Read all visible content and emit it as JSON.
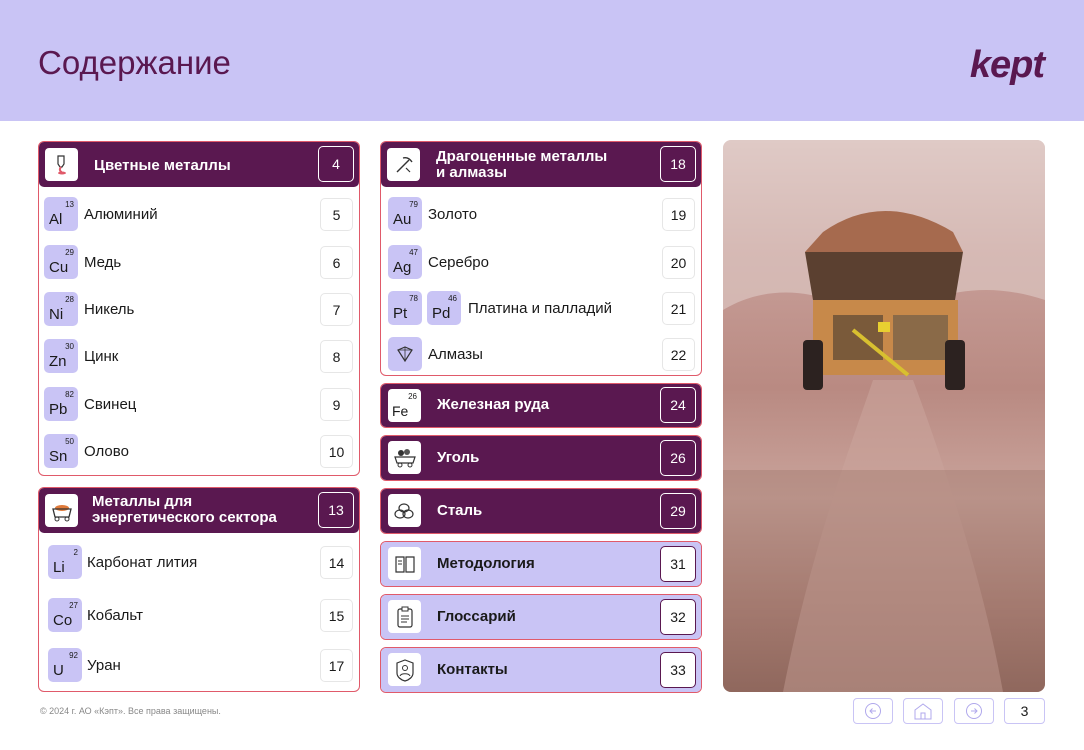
{
  "header": {
    "title": "Содержание",
    "logo": "kept"
  },
  "nonferrous": {
    "title": "Цветные металлы",
    "page": "4",
    "icon": "metal-pour-icon",
    "items": [
      {
        "num": "13",
        "sym": "Al",
        "label": "Алюминий",
        "page": "5"
      },
      {
        "num": "29",
        "sym": "Cu",
        "label": "Медь",
        "page": "6"
      },
      {
        "num": "28",
        "sym": "Ni",
        "label": "Никель",
        "page": "7"
      },
      {
        "num": "30",
        "sym": "Zn",
        "label": "Цинк",
        "page": "8"
      },
      {
        "num": "82",
        "sym": "Pb",
        "label": "Свинец",
        "page": "9"
      },
      {
        "num": "50",
        "sym": "Sn",
        "label": "Олово",
        "page": "10"
      }
    ]
  },
  "energy": {
    "title": "Металлы для\nэнергетического сектора",
    "page": "13",
    "icon": "mine-cart-icon",
    "items": [
      {
        "num": "2",
        "sym": "Li",
        "label": "Карбонат лития",
        "page": "14"
      },
      {
        "num": "27",
        "sym": "Co",
        "label": "Кобальт",
        "page": "15"
      },
      {
        "num": "92",
        "sym": "U",
        "label": "Уран",
        "page": "17"
      }
    ]
  },
  "precious": {
    "title": "Драгоценные металлы\nи алмазы",
    "page": "18",
    "icon": "pickaxe-icon",
    "items": [
      {
        "num": "79",
        "sym": "Au",
        "label": "Золото",
        "page": "19"
      },
      {
        "num": "47",
        "sym": "Ag",
        "label": "Серебро",
        "page": "20"
      },
      {
        "num": "78",
        "sym": "Pt",
        "num2": "46",
        "sym2": "Pd",
        "label": "Платина и палладий",
        "page": "21"
      },
      {
        "label": "Алмазы",
        "page": "22",
        "icon": "diamond-icon"
      }
    ]
  },
  "iron": {
    "title": "Железная руда",
    "page": "24",
    "num": "26",
    "sym": "Fe"
  },
  "coal": {
    "title": "Уголь",
    "page": "26",
    "icon": "coal-cart-icon"
  },
  "steel": {
    "title": "Сталь",
    "page": "29",
    "icon": "steel-pipes-icon"
  },
  "methodology": {
    "title": "Методология",
    "page": "31",
    "icon": "book-icon"
  },
  "glossary": {
    "title": "Глоссарий",
    "page": "32",
    "icon": "clipboard-icon"
  },
  "contacts": {
    "title": "Контакты",
    "page": "33",
    "icon": "person-icon"
  },
  "footer": {
    "copyright": "© 2024 г. АО «Кэпт». Все права защищены.",
    "page": "3"
  },
  "colors": {
    "accent": "#5a1850",
    "lavender": "#c9c4f5",
    "border": "#e05a6a"
  }
}
